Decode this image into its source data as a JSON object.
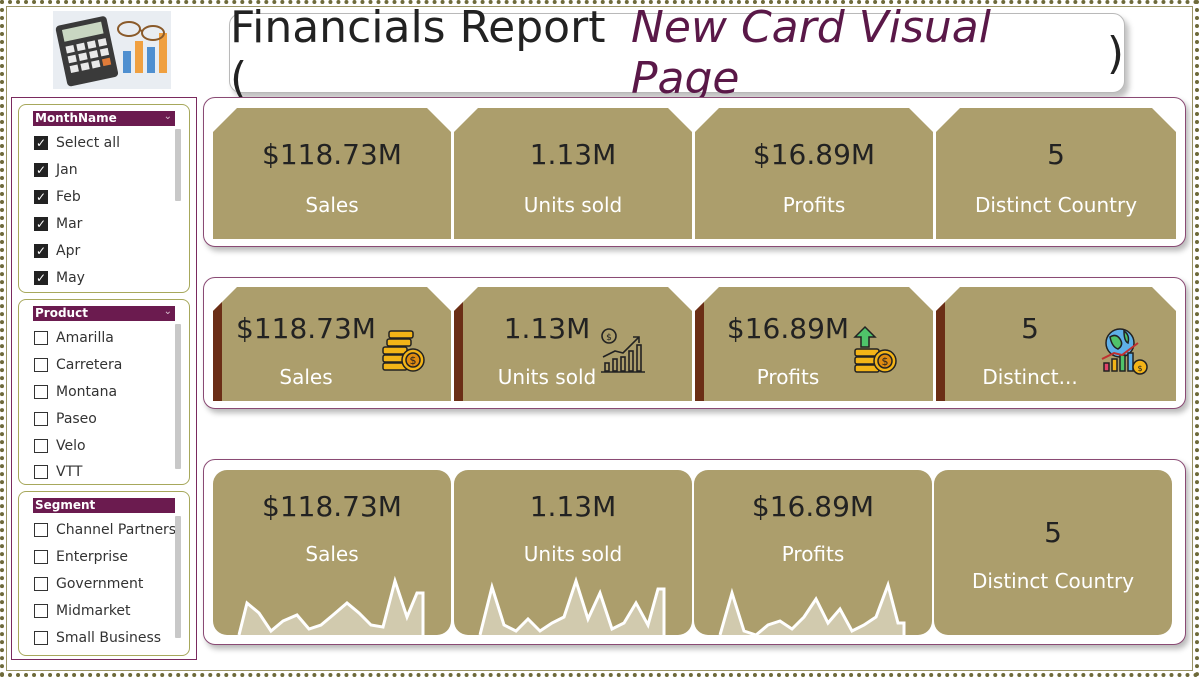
{
  "header": {
    "title_plain": "Financials Report (",
    "title_italic": "New Card Visual Page",
    "title_close": ")"
  },
  "slicers": [
    {
      "title": "MonthName",
      "items": [
        {
          "label": "Select all",
          "checked": true
        },
        {
          "label": "Jan",
          "checked": true
        },
        {
          "label": "Feb",
          "checked": true
        },
        {
          "label": "Mar",
          "checked": true
        },
        {
          "label": "Apr",
          "checked": true
        },
        {
          "label": "May",
          "checked": true
        }
      ]
    },
    {
      "title": "Product",
      "items": [
        {
          "label": "Amarilla",
          "checked": false
        },
        {
          "label": "Carretera",
          "checked": false
        },
        {
          "label": "Montana",
          "checked": false
        },
        {
          "label": "Paseo",
          "checked": false
        },
        {
          "label": "Velo",
          "checked": false
        },
        {
          "label": "VTT",
          "checked": false
        }
      ]
    },
    {
      "title": "Segment",
      "items": [
        {
          "label": "Channel Partners",
          "checked": false
        },
        {
          "label": "Enterprise",
          "checked": false
        },
        {
          "label": "Government",
          "checked": false
        },
        {
          "label": "Midmarket",
          "checked": false
        },
        {
          "label": "Small Business",
          "checked": false
        }
      ]
    }
  ],
  "row1": [
    {
      "value": "$118.73M",
      "label": "Sales"
    },
    {
      "value": "1.13M",
      "label": "Units sold"
    },
    {
      "value": "$16.89M",
      "label": "Profits"
    },
    {
      "value": "5",
      "label": "Distinct Country"
    }
  ],
  "row2": [
    {
      "value": "$118.73M",
      "label": "Sales",
      "icon": "coin-stack-icon"
    },
    {
      "value": "1.13M",
      "label": "Units sold",
      "icon": "growth-chart-icon"
    },
    {
      "value": "$16.89M",
      "label": "Profits",
      "icon": "profit-coins-icon"
    },
    {
      "value": "5",
      "label": "Distinct...",
      "icon": "globe-chart-icon"
    }
  ],
  "row3": [
    {
      "value": "$118.73M",
      "label": "Sales"
    },
    {
      "value": "1.13M",
      "label": "Units sold"
    },
    {
      "value": "$16.89M",
      "label": "Profits"
    },
    {
      "value": "5",
      "label": "Distinct Country"
    }
  ],
  "colors": {
    "card": "#ac9e6c",
    "accent": "#6b1b4f",
    "stripe": "#6b2e16"
  }
}
